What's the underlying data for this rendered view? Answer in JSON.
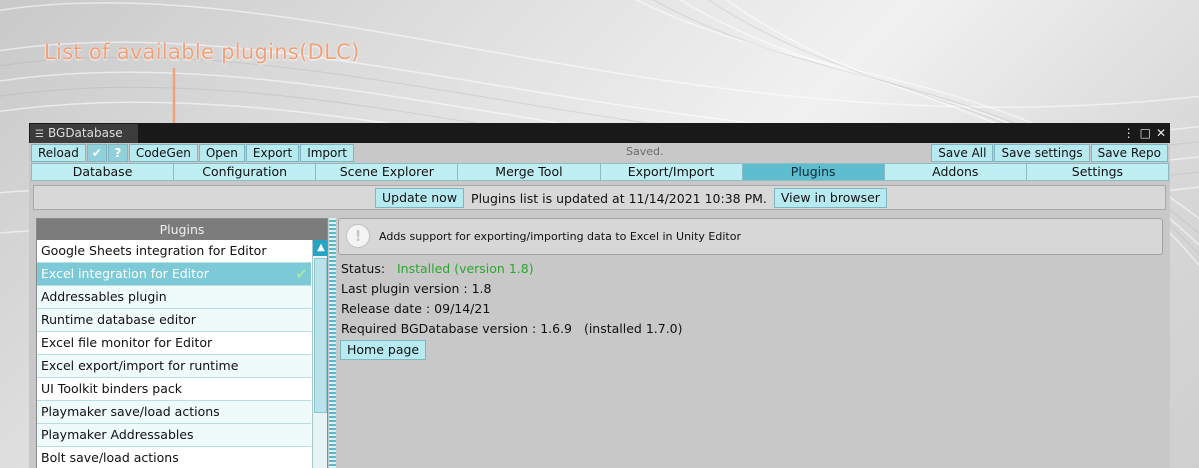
{
  "annotation": "List of available plugins(DLC)",
  "window": {
    "tab_title": "BGDatabase",
    "menu_glyph": "⋮",
    "maximize_glyph": "□",
    "close_glyph": "✕"
  },
  "toolbar": {
    "reload": "Reload",
    "check_glyph": "✔",
    "help_glyph": "?",
    "codegen": "CodeGen",
    "open": "Open",
    "export": "Export",
    "import": "Import",
    "status": "Saved.",
    "save_all": "Save All",
    "save_settings": "Save settings",
    "save_repo": "Save Repo"
  },
  "tabs": [
    "Database",
    "Configuration",
    "Scene Explorer",
    "Merge Tool",
    "Export/Import",
    "Plugins",
    "Addons",
    "Settings"
  ],
  "active_tab": "Plugins",
  "update_bar": {
    "update_button": "Update now",
    "message": "Plugins list is updated at 11/14/2021 10:38 PM.",
    "view_button": "View in browser"
  },
  "plugins_list": {
    "header": "Plugins",
    "items": [
      {
        "label": "Google Sheets integration for Editor"
      },
      {
        "label": "Excel integration for Editor",
        "installed": "✔"
      },
      {
        "label": "Addressables plugin"
      },
      {
        "label": "Runtime database editor"
      },
      {
        "label": "Excel file monitor for Editor"
      },
      {
        "label": "Excel export/import for runtime"
      },
      {
        "label": "UI Toolkit binders pack"
      },
      {
        "label": "Playmaker save/load actions"
      },
      {
        "label": "Playmaker Addressables"
      },
      {
        "label": "Bolt save/load actions"
      }
    ],
    "selected_index": 1,
    "scroll_up_glyph": "▲"
  },
  "details": {
    "info_glyph": "!",
    "description": "Adds support for exporting/importing data to Excel in Unity Editor",
    "status_label": "Status:",
    "status_value": "Installed (version 1.8)",
    "last_version": "Last plugin version : 1.8",
    "release_date": "Release date : 09/14/21",
    "required": "Required BGDatabase version : 1.6.9",
    "installed": "(installed 1.7.0)",
    "home_button": "Home page"
  },
  "colors": {
    "accent": "#5fbdd0",
    "button": "#b7eaf0",
    "installed_green": "#2da62f",
    "annotation": "#f0a179"
  }
}
